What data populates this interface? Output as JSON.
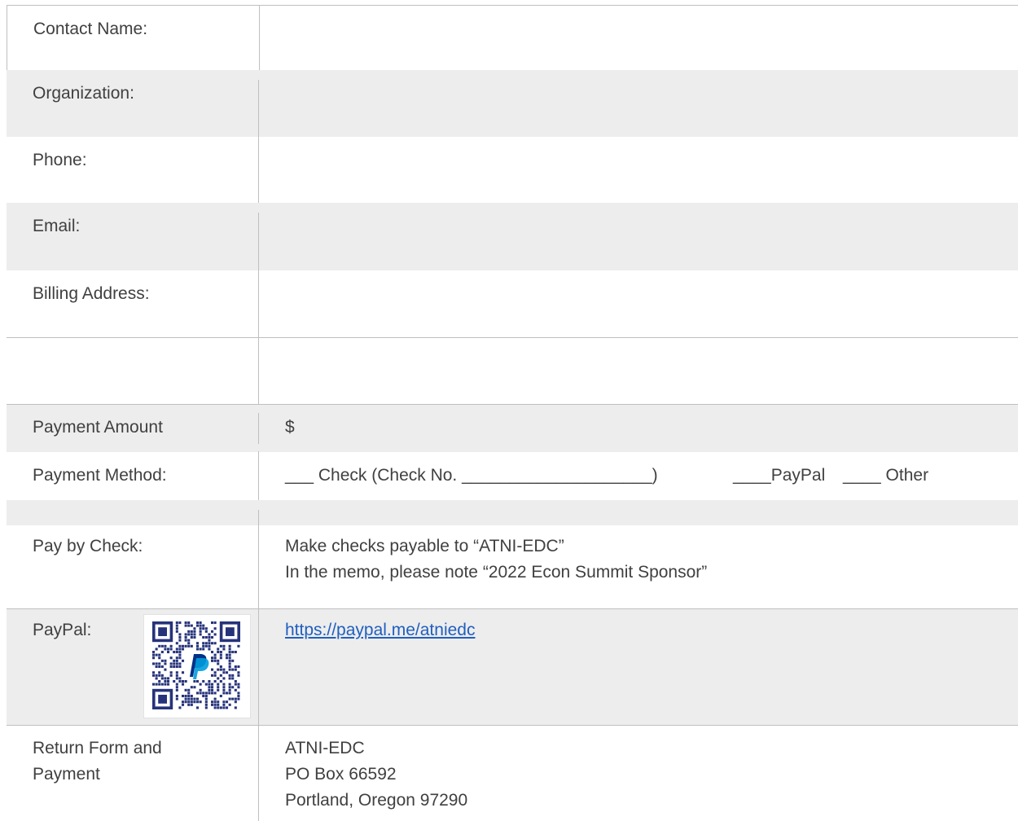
{
  "form": {
    "contact_name_label": "Contact Name:",
    "organization_label": "Organization:",
    "phone_label": "Phone:",
    "email_label": "Email:",
    "billing_address_label": "Billing Address:",
    "payment_amount_label": "Payment Amount",
    "payment_amount_value": "$",
    "payment_method_label": "Payment Method:",
    "payment_method_check": "___ Check (Check No. ____________________)",
    "payment_method_paypal": "____PayPal",
    "payment_method_other": "____ Other",
    "pay_by_check_label": "Pay by Check:",
    "pay_by_check_line1": "Make checks payable to “ATNI-EDC”",
    "pay_by_check_line2": "In the memo, please note “2022 Econ Summit Sponsor”",
    "paypal_label": "PayPal:",
    "paypal_link": "https://paypal.me/atniedc",
    "return_label": "Return Form and\nPayment",
    "return_address": "ATNI-EDC\nPO Box 66592\nPortland, Oregon 97290"
  },
  "colors": {
    "shaded_row": "#ededed",
    "border": "#bfbfbf",
    "text": "#404040",
    "link": "#1f5fbf",
    "qr_dark": "#26337a",
    "paypal_blue": "#003087",
    "paypal_light_blue": "#009cde"
  },
  "icons": {
    "qr": "paypal-qr-code-icon"
  }
}
